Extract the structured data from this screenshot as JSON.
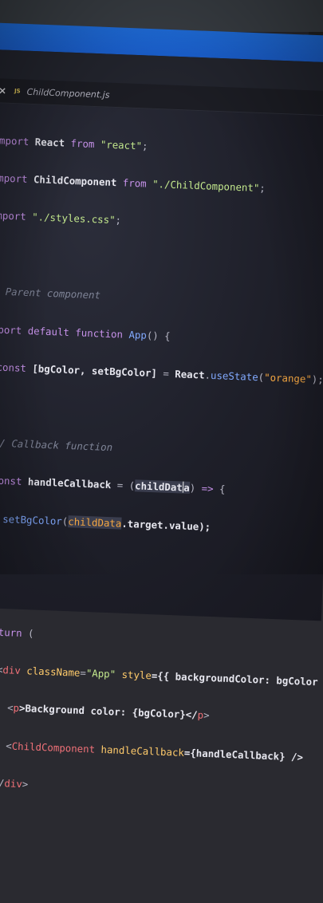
{
  "tab": {
    "close_glyph": "×",
    "lang_badge": "JS",
    "filename": "ChildComponent.js"
  },
  "code": {
    "line1": {
      "kw": "import",
      "id": "React",
      "from": "from",
      "str": "\"react\"",
      "end": ";"
    },
    "line2": {
      "kw": "import",
      "id": "ChildComponent",
      "from": "from",
      "str": "\"./ChildComponent\"",
      "end": ";"
    },
    "line3": {
      "kw": "import",
      "str": "\"./styles.css\"",
      "end": ";"
    },
    "comment1": "// Parent component",
    "line5": {
      "kw1": "export",
      "kw2": "default",
      "kw3": "function",
      "name": "App",
      "rest": "() {"
    },
    "line6": {
      "kw": "const",
      "destructure": "[bgColor, setBgColor]",
      "eq": "=",
      "obj": "React",
      "dot": ".",
      "method": "useState",
      "open": "(",
      "str": "\"orange\"",
      "close": ");"
    },
    "comment2": "// Callback function",
    "line8": {
      "kw": "const",
      "name": "handleCallback",
      "eq": "=",
      "open": "(",
      "param_a": "childDat",
      "param_b": "a",
      "close": ")",
      "arrow": "=>",
      "brace": "{"
    },
    "line9": {
      "fn": "setBgColor",
      "open": "(",
      "param": "childData",
      "rest": ".target.value);"
    },
    "line10": "};",
    "line11": {
      "kw": "return",
      "rest": "("
    },
    "line12": {
      "open": "<",
      "tag": "div",
      "attr1": "className",
      "eq1": "=",
      "val1": "\"App\"",
      "attr2": "style",
      "rest": "={{ backgroundColor: bgColor }}"
    },
    "line13": {
      "open": "<",
      "tag": "p",
      "text": ">Background color: {bgColor}</",
      "tag2": "p",
      "close": ">"
    },
    "line14": {
      "open": "<",
      "tag": "ChildComponent",
      "attr": "handleCallback",
      "rest": "={handleCallback} />"
    },
    "line15": {
      "open": "</",
      "tag": "div",
      "close": ">"
    },
    "line16": ");",
    "line17": "}"
  }
}
